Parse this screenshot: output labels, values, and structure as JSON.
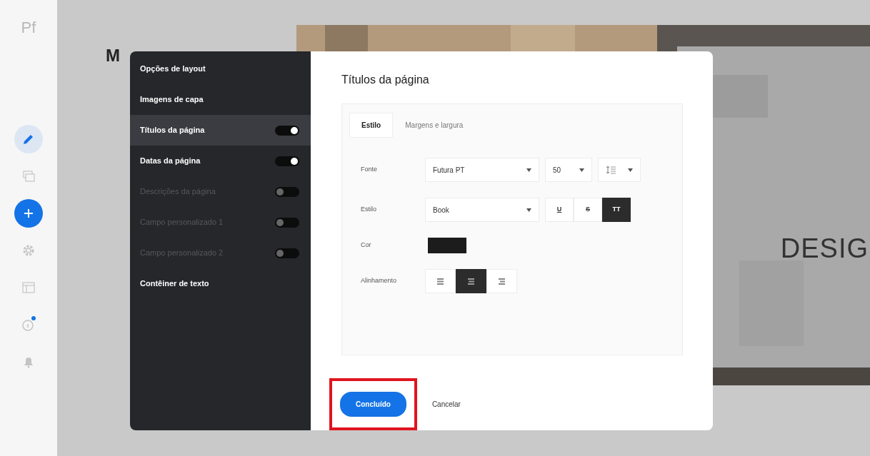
{
  "rail": {
    "logo": "Pf",
    "tools": [
      {
        "kind": "edit",
        "selected": true
      },
      {
        "kind": "pages",
        "selected": false
      },
      {
        "kind": "add",
        "selected": false
      },
      {
        "kind": "settings",
        "selected": false
      },
      {
        "kind": "layout",
        "selected": false
      },
      {
        "kind": "info",
        "selected": false,
        "notified": true
      },
      {
        "kind": "bell",
        "selected": false
      }
    ]
  },
  "site_title": "M",
  "cover_title": "DESIG",
  "dialog": {
    "menu": [
      {
        "label": "Opções de layout",
        "kind": "link",
        "selected": false,
        "enabled": true
      },
      {
        "label": "Imagens de capa",
        "kind": "link",
        "selected": false,
        "enabled": true
      },
      {
        "label": "Títulos da página",
        "kind": "toggle",
        "on": true,
        "selected": true,
        "enabled": true
      },
      {
        "label": "Datas da página",
        "kind": "toggle",
        "on": true,
        "selected": false,
        "enabled": true
      },
      {
        "label": "Descrições da página",
        "kind": "toggle",
        "on": false,
        "selected": false,
        "enabled": false
      },
      {
        "label": "Campo personalizado 1",
        "kind": "toggle",
        "on": false,
        "selected": false,
        "enabled": false
      },
      {
        "label": "Campo personalizado 2",
        "kind": "toggle",
        "on": false,
        "selected": false,
        "enabled": false
      },
      {
        "label": "Contêiner de texto",
        "kind": "link",
        "selected": false,
        "enabled": true
      }
    ],
    "title": "Títulos da página",
    "tabs": [
      {
        "label": "Estilo",
        "selected": true
      },
      {
        "label": "Margens e largura",
        "selected": false
      }
    ],
    "font": {
      "label": "Fonte",
      "family": "Futura PT",
      "size": "50"
    },
    "style": {
      "label": "Estilo",
      "weight": "Book",
      "toggles": [
        {
          "label": "U",
          "kind": "underline",
          "selected": false
        },
        {
          "label": "S",
          "kind": "strike",
          "selected": false
        },
        {
          "label": "TT",
          "kind": "caps",
          "selected": true
        }
      ]
    },
    "color": {
      "label": "Cor",
      "color": "#1c1c1c"
    },
    "alignment": {
      "label": "Alinhamento",
      "options": [
        {
          "kind": "left",
          "selected": false
        },
        {
          "kind": "center",
          "selected": true
        },
        {
          "kind": "right",
          "selected": false
        }
      ]
    },
    "buttons": {
      "primary": "Concluído",
      "secondary": "Cancelar",
      "highlighted": true
    }
  }
}
